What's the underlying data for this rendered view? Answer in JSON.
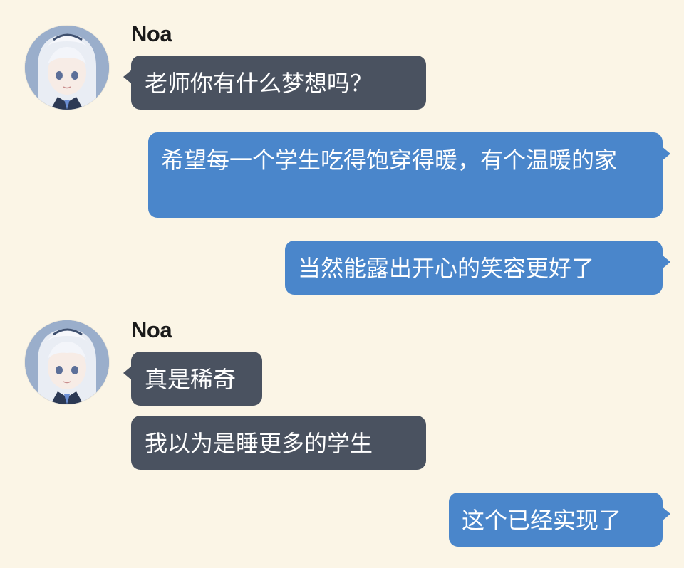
{
  "chat": {
    "sender_name": "Noa",
    "messages": [
      {
        "side": "in",
        "text": "老师你有什么梦想吗？"
      },
      {
        "side": "out",
        "text": "希望每一个学生吃得饱穿得暖，有个温暖的家"
      },
      {
        "side": "out",
        "text": "当然能露出开心的笑容更好了"
      },
      {
        "side": "in",
        "text": "真是稀奇"
      },
      {
        "side": "in",
        "text": "我以为是睡更多的学生"
      },
      {
        "side": "out",
        "text": "这个已经实现了"
      }
    ]
  },
  "colors": {
    "background": "#fbf5e6",
    "incoming_bubble": "#4a5260",
    "outgoing_bubble": "#4a86cb",
    "bubble_text": "#ffffff"
  },
  "icons": [
    "avatar-noa-icon"
  ]
}
